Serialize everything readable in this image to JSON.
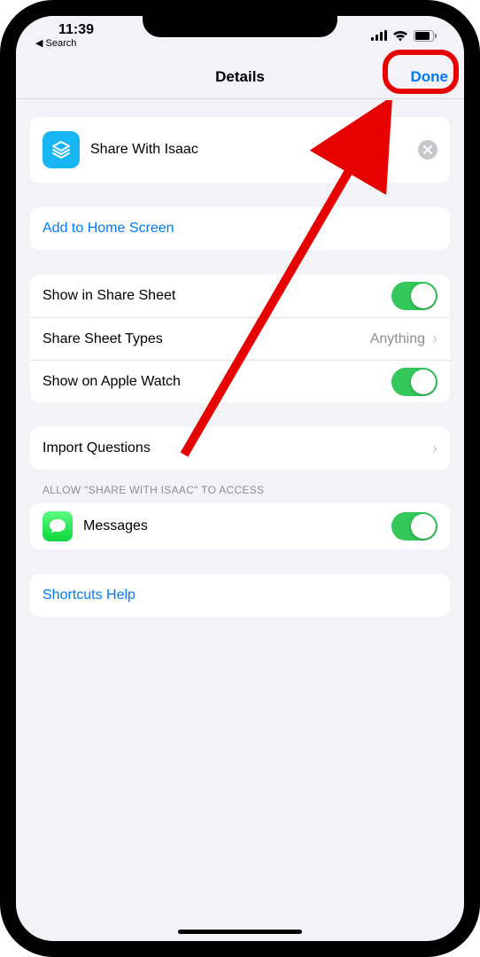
{
  "status_bar": {
    "time": "11:39",
    "back_label": "Search"
  },
  "nav": {
    "title": "Details",
    "done": "Done"
  },
  "shortcut": {
    "name": "Share With Isaac"
  },
  "actions": {
    "add_home": "Add to Home Screen"
  },
  "options": {
    "share_sheet": "Show in Share Sheet",
    "share_types_label": "Share Sheet Types",
    "share_types_value": "Anything",
    "apple_watch": "Show on Apple Watch"
  },
  "import": {
    "label": "Import Questions"
  },
  "access": {
    "header": "ALLOW \"SHARE WITH ISAAC\" TO ACCESS",
    "messages": "Messages"
  },
  "help": {
    "label": "Shortcuts Help"
  }
}
